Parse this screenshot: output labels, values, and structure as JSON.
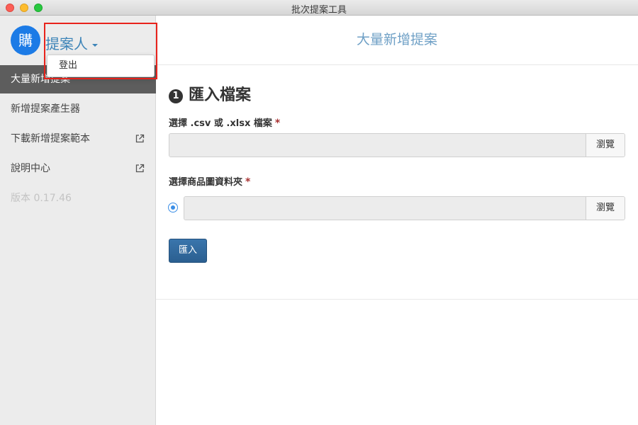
{
  "window": {
    "title": "批次提案工具"
  },
  "sidebar": {
    "avatar_text": "購",
    "user_name": "提案人",
    "dropdown": {
      "logout_label": "登出"
    },
    "items": [
      {
        "label": "大量新增提案",
        "active": true
      },
      {
        "label": "新增提案產生器"
      },
      {
        "label": "下載新增提案範本",
        "external": true
      },
      {
        "label": "說明中心",
        "external": true
      }
    ],
    "version": "版本 0.17.46"
  },
  "main": {
    "header_title": "大量新增提案",
    "step_number": "1",
    "section_title": "匯入檔案",
    "file_field": {
      "label": "選擇 .csv 或 .xlsx 檔案",
      "required_mark": "*",
      "browse_label": "瀏覽"
    },
    "folder_field": {
      "label": "選擇商品圖資料夾",
      "required_mark": "*",
      "browse_label": "瀏覽"
    },
    "import_label": "匯入"
  },
  "colors": {
    "accent": "#3d84b8",
    "active_nav": "#5d5d5d",
    "primary_button": "#2f6699",
    "highlight": "#e8231c"
  }
}
